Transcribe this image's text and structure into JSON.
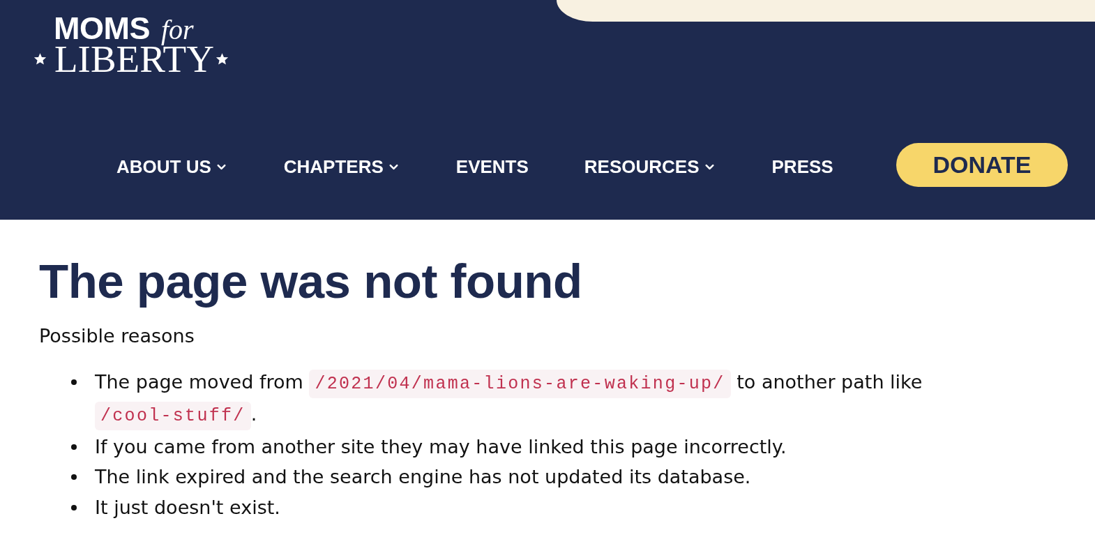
{
  "header": {
    "logo": {
      "word_1": "MOMS",
      "word_2": "for",
      "word_3": "LIBERTY"
    },
    "nav": [
      {
        "label": "ABOUT US",
        "has_menu": true
      },
      {
        "label": "CHAPTERS",
        "has_menu": true
      },
      {
        "label": "EVENTS",
        "has_menu": false
      },
      {
        "label": "RESOURCES",
        "has_menu": true
      },
      {
        "label": "PRESS",
        "has_menu": false
      }
    ],
    "donate": "DONATE"
  },
  "main": {
    "title": "The page was not found",
    "intro": "Possible reasons",
    "reasons": [
      {
        "segments": [
          {
            "kind": "text",
            "text": "The page moved from "
          },
          {
            "kind": "code",
            "text": "/2021/04/mama-lions-are-waking-up/"
          },
          {
            "kind": "text",
            "text": " to another path like "
          },
          {
            "kind": "code",
            "text": "/cool-stuff/"
          },
          {
            "kind": "text",
            "text": "."
          }
        ]
      },
      {
        "segments": [
          {
            "kind": "text",
            "text": "If you came from another site they may have linked this page incorrectly."
          }
        ]
      },
      {
        "segments": [
          {
            "kind": "text",
            "text": "The link expired and the search engine has not updated its database."
          }
        ]
      },
      {
        "segments": [
          {
            "kind": "text",
            "text": "It just doesn't exist."
          }
        ]
      }
    ]
  }
}
